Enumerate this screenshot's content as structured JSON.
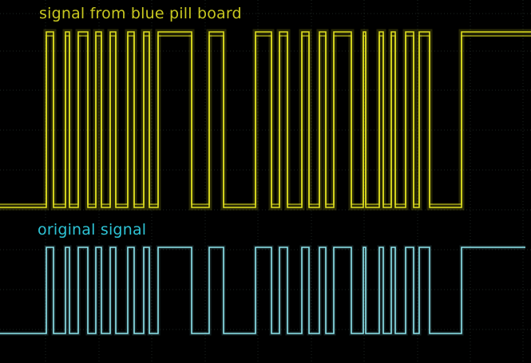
{
  "annotations": {
    "top_label": "signal from blue pill board",
    "bottom_label": "original signal"
  },
  "colors": {
    "background": "#000000",
    "grid": "#1c2420",
    "top_trace": "#e0e020",
    "top_label": "#c8c820",
    "bottom_trace": "#8fe6ee",
    "bottom_label": "#2ec4d6"
  },
  "grid": {
    "visible": true,
    "style": "dotted"
  }
}
